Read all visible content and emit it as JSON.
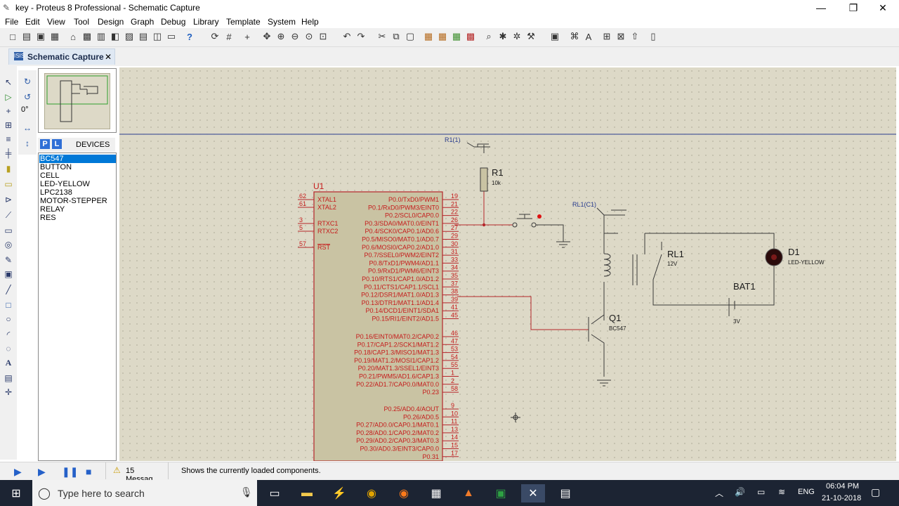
{
  "window": {
    "title": "key - Proteus 8 Professional - Schematic Capture",
    "controls": {
      "minimize": "—",
      "maximize": "❐",
      "close": "✕"
    }
  },
  "menu": [
    "File",
    "Edit",
    "View",
    "Tool",
    "Design",
    "Graph",
    "Debug",
    "Library",
    "Template",
    "System",
    "Help"
  ],
  "tab": {
    "label": "Schematic Capture",
    "close": "✕"
  },
  "rotation": {
    "angle": "0°"
  },
  "devices": {
    "p_label": "P",
    "l_label": "L",
    "header": "DEVICES",
    "items": [
      "BC547",
      "BUTTON",
      "CELL",
      "LED-YELLOW",
      "LPC2138",
      "MOTOR-STEPPER",
      "RELAY",
      "RES"
    ],
    "selected": "BC547"
  },
  "schematic": {
    "u1": {
      "ref": "U1",
      "left_pins": [
        {
          "num": "62",
          "name": "XTAL1"
        },
        {
          "num": "61",
          "name": "XTAL2"
        },
        {
          "num": "3",
          "name": "RTXC1"
        },
        {
          "num": "5",
          "name": "RTXC2"
        },
        {
          "num": "57",
          "name": "RST"
        }
      ],
      "right_pins": [
        {
          "num": "19",
          "name": "P0.0/TxD0/PWM1"
        },
        {
          "num": "21",
          "name": "P0.1/RxD0/PWM3/EINT0"
        },
        {
          "num": "22",
          "name": "P0.2/SCL0/CAP0.0"
        },
        {
          "num": "26",
          "name": "P0.3/SDA0/MAT0.0/EINT1"
        },
        {
          "num": "27",
          "name": "P0.4/SCK0/CAP0.1/AD0.6"
        },
        {
          "num": "29",
          "name": "P0.5/MISO0/MAT0.1/AD0.7"
        },
        {
          "num": "30",
          "name": "P0.6/MOSI0/CAP0.2/AD1.0"
        },
        {
          "num": "31",
          "name": "P0.7/SSEL0/PWM2/EINT2"
        },
        {
          "num": "33",
          "name": "P0.8/TxD1/PWM4/AD1.1"
        },
        {
          "num": "34",
          "name": "P0.9/RxD1/PWM6/EINT3"
        },
        {
          "num": "35",
          "name": "P0.10/RTS1/CAP1.0/AD1.2"
        },
        {
          "num": "37",
          "name": "P0.11/CTS1/CAP1.1/SCL1"
        },
        {
          "num": "38",
          "name": "P0.12/DSR1/MAT1.0/AD1.3"
        },
        {
          "num": "39",
          "name": "P0.13/DTR1/MAT1.1/AD1.4"
        },
        {
          "num": "41",
          "name": "P0.14/DCD1/EINT1/SDA1"
        },
        {
          "num": "45",
          "name": "P0.15/RI1/EINT2/AD1.5"
        },
        {
          "num": "46",
          "name": "P0.16/EINT0/MAT0.2/CAP0.2"
        },
        {
          "num": "47",
          "name": "P0.17/CAP1.2/SCK1/MAT1.2"
        },
        {
          "num": "53",
          "name": "P0.18/CAP1.3/MISO1/MAT1.3"
        },
        {
          "num": "54",
          "name": "P0.19/MAT1.2/MOSI1/CAP1.2"
        },
        {
          "num": "55",
          "name": "P0.20/MAT1.3/SSEL1/EINT3"
        },
        {
          "num": "1",
          "name": "P0.21/PWM5/AD1.6/CAP1.3"
        },
        {
          "num": "2",
          "name": "P0.22/AD1.7/CAP0.0/MAT0.0"
        },
        {
          "num": "58",
          "name": "P0.23"
        },
        {
          "num": "9",
          "name": "P0.25/AD0.4/AOUT"
        },
        {
          "num": "10",
          "name": "P0.26/AD0.5"
        },
        {
          "num": "11",
          "name": "P0.27/AD0.0/CAP0.1/MAT0.1"
        },
        {
          "num": "13",
          "name": "P0.28/AD0.1/CAP0.2/MAT0.2"
        },
        {
          "num": "14",
          "name": "P0.29/AD0.2/CAP0.3/MAT0.3"
        },
        {
          "num": "15",
          "name": "P0.30/AD0.3/EINT3/CAP0.0"
        },
        {
          "num": "17",
          "name": "P0.31"
        }
      ]
    },
    "r1": {
      "ref": "R1",
      "value": "10k",
      "pin_label": "R1(1)"
    },
    "rl1": {
      "ref": "RL1",
      "value": "12V",
      "pin_label": "RL1(C1)"
    },
    "d1": {
      "ref": "D1",
      "value": "LED-YELLOW"
    },
    "bat1": {
      "ref": "BAT1",
      "value": "3V"
    },
    "q1": {
      "ref": "Q1",
      "value": "BC547"
    },
    "colors": {
      "sheet": "#ddd9c7",
      "wire": "#b5262a",
      "chip": "#c9c3a3"
    }
  },
  "status": {
    "messages": "15 Messag...",
    "text": "Shows the currently loaded components."
  },
  "taskbar": {
    "search_placeholder": "Type here to search",
    "lang": "ENG",
    "time": "06:04 PM",
    "date": "21-10-2018"
  }
}
